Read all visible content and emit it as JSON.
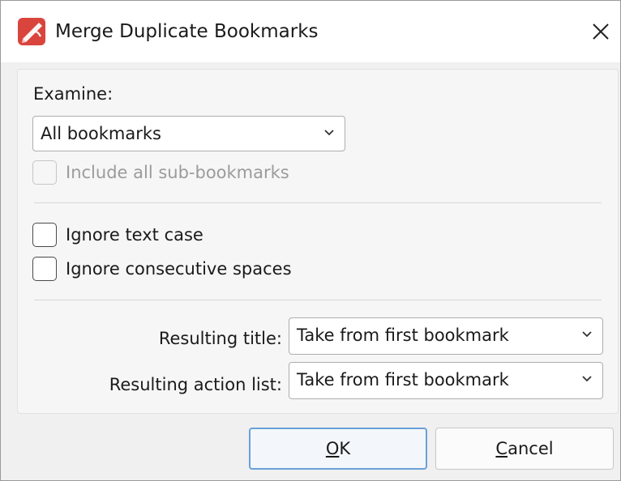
{
  "dialog": {
    "title": "Merge Duplicate Bookmarks",
    "icons": {
      "app": "foxit-pdf-editor-icon",
      "close": "close-icon"
    }
  },
  "examine": {
    "label": "Examine:",
    "selected": "All bookmarks"
  },
  "include_sub": {
    "label": "Include all sub-bookmarks",
    "checked": false,
    "enabled": false
  },
  "options": {
    "ignore_case": {
      "label": "Ignore text case",
      "checked": false
    },
    "ignore_spaces": {
      "label": "Ignore consecutive spaces",
      "checked": false
    }
  },
  "resulting_title": {
    "label": "Resulting title:",
    "selected": "Take from first bookmark"
  },
  "resulting_action": {
    "label": "Resulting action list:",
    "selected": "Take from first bookmark"
  },
  "buttons": {
    "ok": {
      "mnemonic": "O",
      "rest": "K"
    },
    "cancel": {
      "mnemonic": "C",
      "rest": "ancel"
    }
  },
  "colors": {
    "accent": "#6aa0d8",
    "icon_red": "#d9453d"
  }
}
